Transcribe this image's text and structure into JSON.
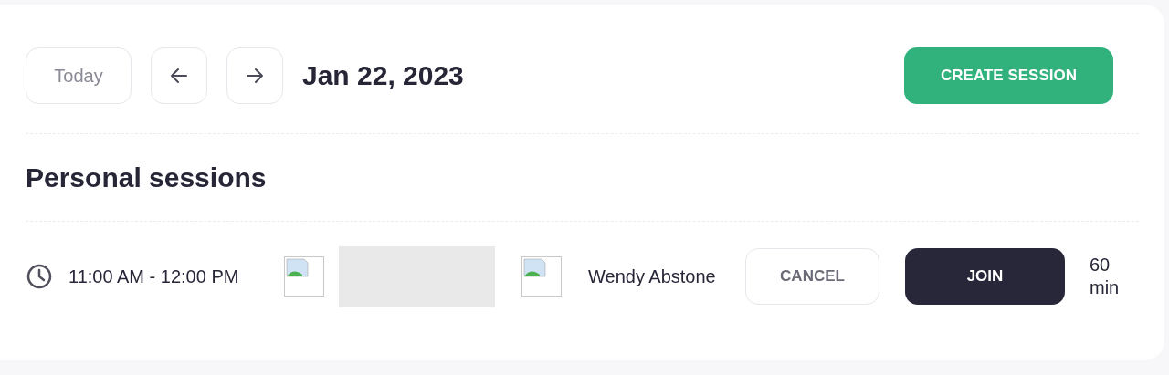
{
  "toolbar": {
    "today_button": "Today",
    "date": "Jan 22, 2023",
    "create_button": "CREATE SESSION"
  },
  "section": {
    "title": "Personal sessions"
  },
  "sessions": [
    {
      "time": "11:00 AM - 12:00 PM",
      "name": "Wendy Abstone",
      "cancel_button": "CANCEL",
      "join_button": "JOIN",
      "duration": "60 min"
    }
  ]
}
